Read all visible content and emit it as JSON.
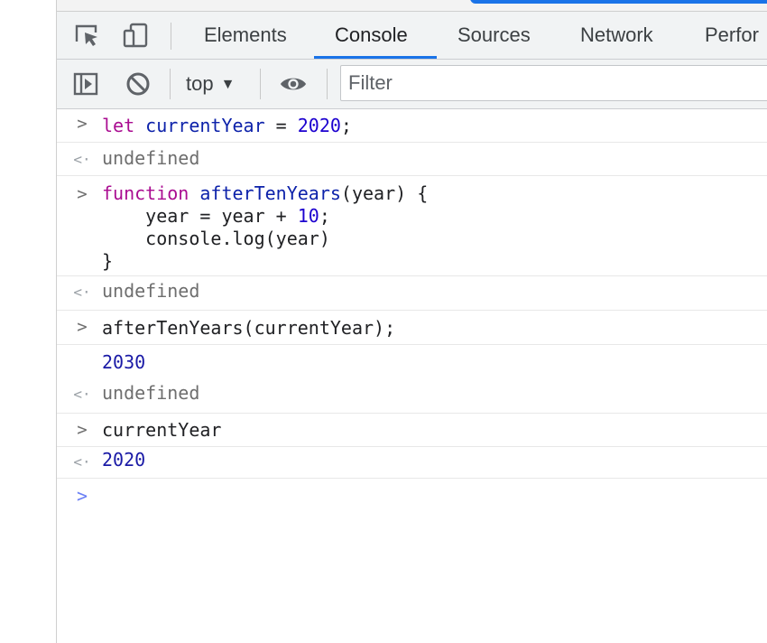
{
  "devtools": {
    "tabs": [
      {
        "label": "Elements",
        "active": false
      },
      {
        "label": "Console",
        "active": true
      },
      {
        "label": "Sources",
        "active": false
      },
      {
        "label": "Network",
        "active": false
      },
      {
        "label": "Perfor",
        "active": false
      }
    ],
    "toolbar": {
      "context": "top",
      "filter_placeholder": "Filter"
    }
  },
  "console": {
    "line1": {
      "kw": "let",
      "var": "currentYear",
      "op": " = ",
      "num": "2020",
      "end": ";"
    },
    "out1": "undefined",
    "line2": {
      "kw": "function",
      "name": "afterTenYears",
      "params": "(year) {",
      "body1_pre": "    year = year + ",
      "body1_num": "10",
      "body1_end": ";",
      "body2": "    console.log(year)",
      "close": "}"
    },
    "out2": "undefined",
    "line3": "afterTenYears(currentYear);",
    "log1": "2030",
    "out3": "undefined",
    "line4": "currentYear",
    "out4": "2020"
  },
  "colors": {
    "accent": "#1a73e8",
    "keyword": "#aa0d91",
    "variable": "#1c00cf",
    "number": "#1c00cf",
    "prompt": "#6a7ff5",
    "muted": "#6e6e6e"
  }
}
